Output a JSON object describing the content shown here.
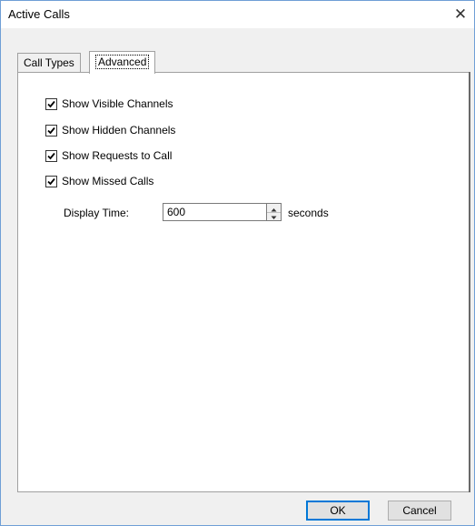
{
  "window": {
    "title": "Active Calls",
    "close_glyph": "✕"
  },
  "tabs": [
    {
      "label": "Call Types",
      "selected": false
    },
    {
      "label": "Advanced",
      "selected": true
    }
  ],
  "advanced": {
    "options": [
      {
        "label": "Show Visible Channels",
        "checked": true
      },
      {
        "label": "Show Hidden Channels",
        "checked": true
      },
      {
        "label": "Show Requests to Call",
        "checked": true
      },
      {
        "label": "Show Missed Calls",
        "checked": true
      }
    ],
    "display_time": {
      "label": "Display Time:",
      "value": "600",
      "units": "seconds"
    }
  },
  "buttons": {
    "ok": "OK",
    "cancel": "Cancel"
  },
  "colors": {
    "window_border": "#6f9fd6",
    "default_button_border": "#0078d7"
  },
  "icons": {
    "close": "close-icon",
    "check": "checkmark-icon",
    "spin_up": "spin-up-arrow-icon",
    "spin_down": "spin-down-arrow-icon"
  }
}
